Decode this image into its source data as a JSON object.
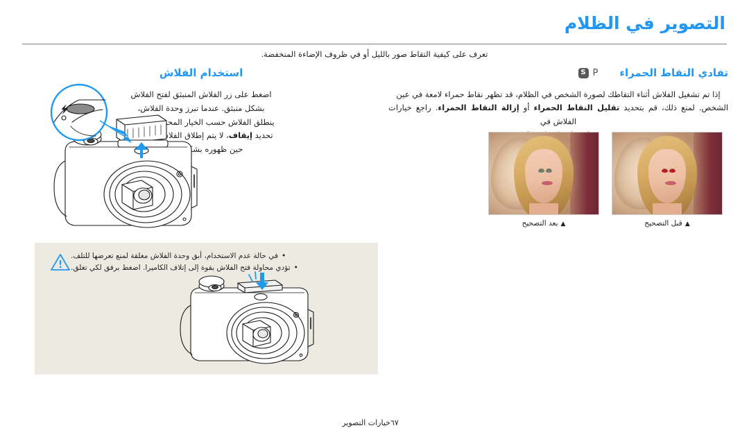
{
  "page": {
    "title": "التصوير في الظلام",
    "intro": "تعرف على كيفية التقاط صور بالليل أو في ظروف الإضاءة المنخفضة."
  },
  "right_section": {
    "heading": "تفادي النقاط الحمراء",
    "mode_badges": [
      "S",
      "P"
    ],
    "body_line1": "إذا تم تشغيل الفلاش أثناء التقاطك لصورة الشخص في الظلام، قد تظهر نقاط حمراء لامعة في عين",
    "body_line2": "الشخص. لمنع ذلك، قم بتحديد تقليل النقاط الحمراء أو إزالة النقاط الحمراء. راجع خيارات الفلاش في",
    "body_line3": "\"ضبط خيار فلاش.\"",
    "bold_terms": [
      "تقليل النقاط الحمراء",
      "إزالة النقاط الحمراء"
    ],
    "photos": [
      {
        "caption": "قبل التصحيح",
        "marker": "▲",
        "state": "redeye"
      },
      {
        "caption": "بعد التصحيح",
        "marker": "▲",
        "state": "corrected"
      }
    ]
  },
  "left_section": {
    "heading": "استخدام الفلاش",
    "body_line1": "اضغط على زر الفلاش المنبثق لفتح الفلاش",
    "body_line2": "بشكل منبثق. عندما تبرز وحدة الفلاش،",
    "body_line3": "ينطلق الفلاش حسب الخيار المحدد. في حالة",
    "body_line4": "تحديد إيقاف، لا يتم إطلاق الفلاش حتى في",
    "body_line5": "حين ظهوره بشكل منبثق.",
    "bold_terms": [
      "إيقاف"
    ]
  },
  "note_box": {
    "icon": "warning-triangle-icon",
    "bullets": [
      "في حالة عدم الاستخدام، أبق وحدة الفلاش مغلقة لمنع تعرضها للتلف.",
      "تؤدي محاولة فتح الفلاش بقوة إلى إتلاف الكاميرا. اضغط برفق لكي تغلق."
    ],
    "bullet_char": "•"
  },
  "illustrations": {
    "camera_flash_button": "camera-flash-button-illustration",
    "camera_flash_close": "camera-flash-close-illustration"
  },
  "footer": {
    "chapter": "خيارات التصوير",
    "page_number": "٦٧"
  },
  "colors": {
    "accent": "#2196f3",
    "text": "#231f20",
    "panel": "#edeae2",
    "badge": "#595959"
  }
}
